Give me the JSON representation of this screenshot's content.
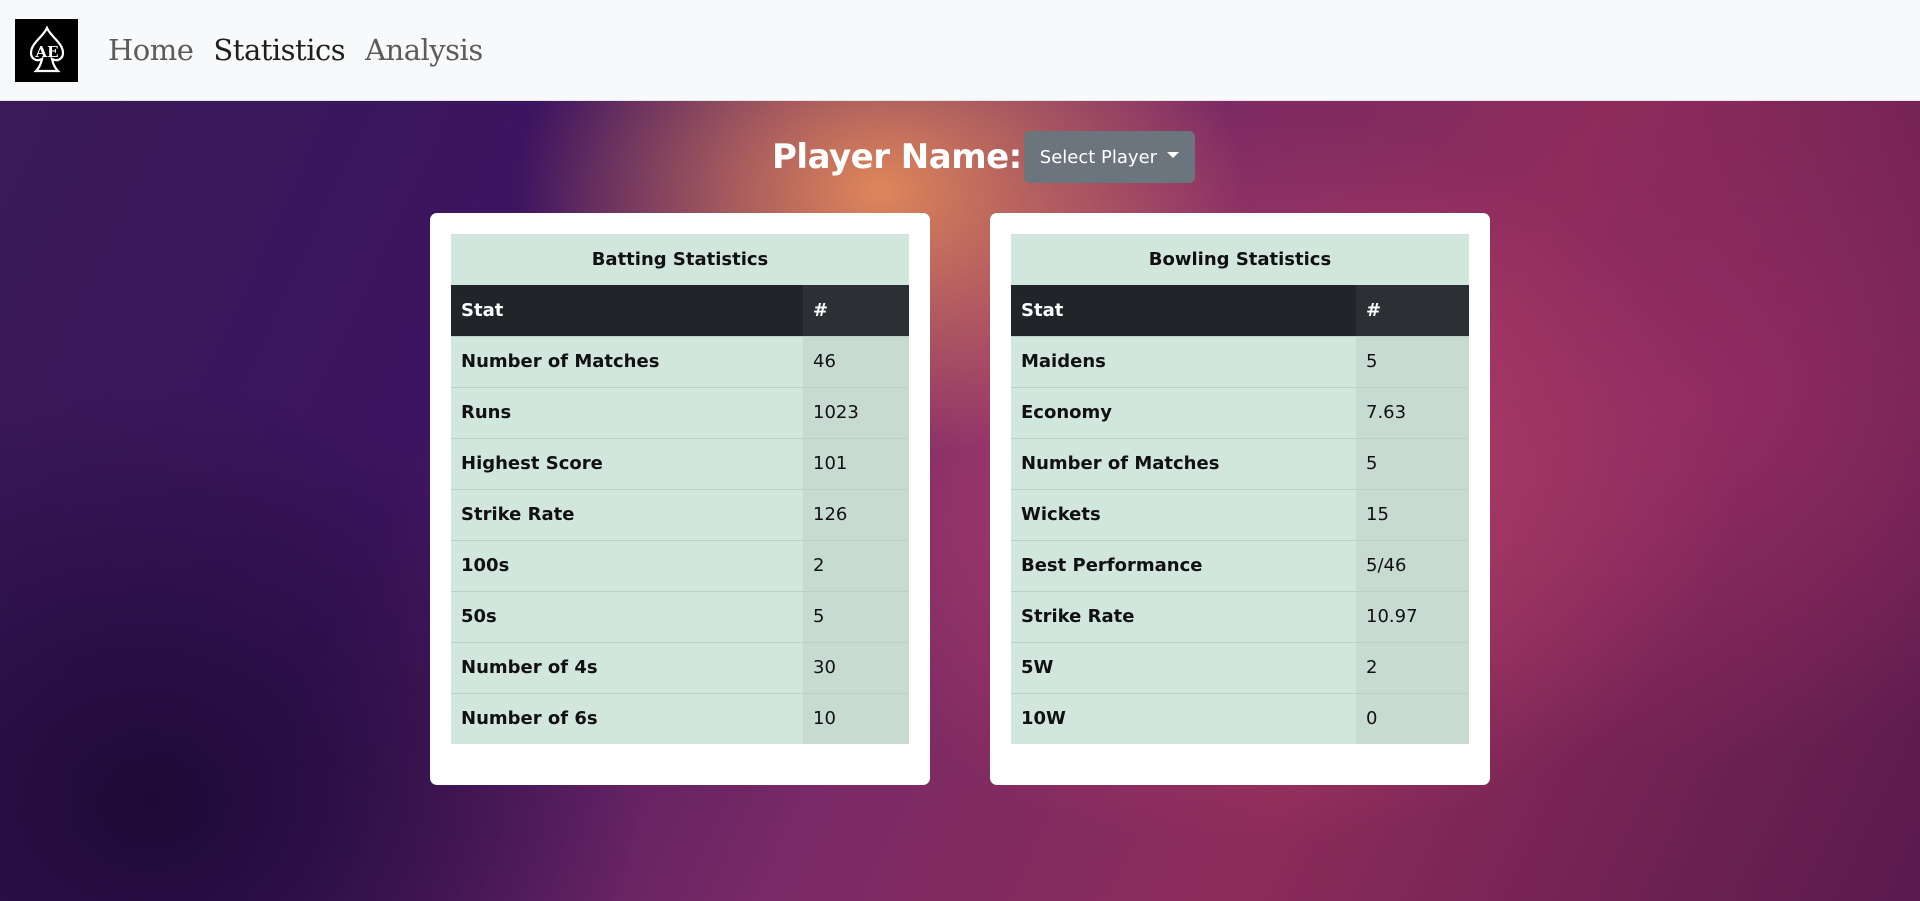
{
  "nav": {
    "logo_text": "AE",
    "links": [
      "Home",
      "Statistics",
      "Analysis"
    ]
  },
  "player": {
    "label": "Player Name:",
    "select_label": "Select Player"
  },
  "batting": {
    "title": "Batting Statistics",
    "columns": [
      "Stat",
      "#"
    ],
    "rows": [
      {
        "stat": "Number of Matches",
        "value": "46"
      },
      {
        "stat": "Runs",
        "value": "1023"
      },
      {
        "stat": "Highest Score",
        "value": "101"
      },
      {
        "stat": "Strike Rate",
        "value": "126"
      },
      {
        "stat": "100s",
        "value": "2"
      },
      {
        "stat": "50s",
        "value": "5"
      },
      {
        "stat": "Number of 4s",
        "value": "30"
      },
      {
        "stat": "Number of 6s",
        "value": "10"
      }
    ]
  },
  "bowling": {
    "title": "Bowling Statistics",
    "columns": [
      "Stat",
      "#"
    ],
    "rows": [
      {
        "stat": "Maidens",
        "value": "5"
      },
      {
        "stat": "Economy",
        "value": "7.63"
      },
      {
        "stat": "Number of Matches",
        "value": "5"
      },
      {
        "stat": "Wickets",
        "value": "15"
      },
      {
        "stat": "Best Performance",
        "value": "5/46"
      },
      {
        "stat": "Strike Rate",
        "value": "10.97"
      },
      {
        "stat": "5W",
        "value": "2"
      },
      {
        "stat": "10W",
        "value": "0"
      }
    ]
  }
}
